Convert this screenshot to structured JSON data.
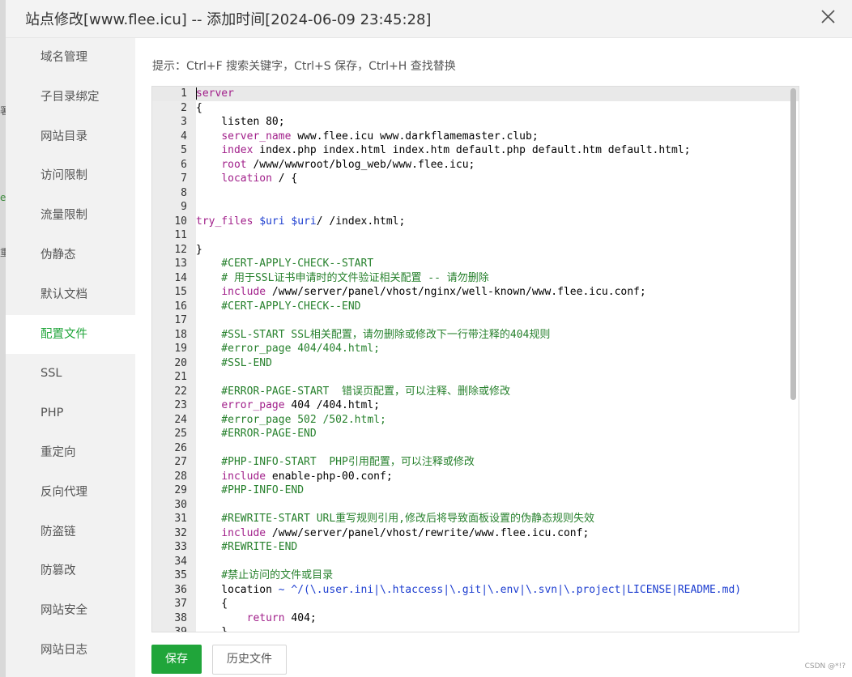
{
  "dialog": {
    "title": "站点修改[www.flee.icu] -- 添加时间[2024-06-09 23:45:28]"
  },
  "backdrop_glyphs": [
    "署",
    "e",
    "重"
  ],
  "sidebar": {
    "active_index": 7,
    "items": [
      {
        "label": "域名管理"
      },
      {
        "label": "子目录绑定"
      },
      {
        "label": "网站目录"
      },
      {
        "label": "访问限制"
      },
      {
        "label": "流量限制"
      },
      {
        "label": "伪静态"
      },
      {
        "label": "默认文档"
      },
      {
        "label": "配置文件"
      },
      {
        "label": "SSL"
      },
      {
        "label": "PHP"
      },
      {
        "label": "重定向"
      },
      {
        "label": "反向代理"
      },
      {
        "label": "防盗链"
      },
      {
        "label": "防篡改"
      },
      {
        "label": "网站安全"
      },
      {
        "label": "网站日志"
      }
    ]
  },
  "editor": {
    "hint": "提示：Ctrl+F 搜索关键字，Ctrl+S 保存，Ctrl+H 查找替换",
    "lines": [
      {
        "n": "1",
        "parts": [
          {
            "t": "server",
            "c": "kw"
          }
        ]
      },
      {
        "n": "2",
        "parts": [
          {
            "t": "{",
            "c": ""
          }
        ]
      },
      {
        "n": "3",
        "parts": [
          {
            "t": "    listen 80;",
            "c": ""
          }
        ]
      },
      {
        "n": "4",
        "parts": [
          {
            "t": "    ",
            "c": ""
          },
          {
            "t": "server_name",
            "c": "kw"
          },
          {
            "t": " www.flee.icu www.darkflamemaster.club;",
            "c": ""
          }
        ]
      },
      {
        "n": "5",
        "parts": [
          {
            "t": "    ",
            "c": ""
          },
          {
            "t": "index",
            "c": "kw"
          },
          {
            "t": " index.php index.html index.htm default.php default.htm default.html;",
            "c": ""
          }
        ]
      },
      {
        "n": "6",
        "parts": [
          {
            "t": "    ",
            "c": ""
          },
          {
            "t": "root",
            "c": "kw"
          },
          {
            "t": " /www/wwwroot/blog_web/www.flee.icu;",
            "c": ""
          }
        ]
      },
      {
        "n": "7",
        "parts": [
          {
            "t": "    ",
            "c": ""
          },
          {
            "t": "location",
            "c": "kw"
          },
          {
            "t": " / {",
            "c": ""
          }
        ]
      },
      {
        "n": "8",
        "parts": []
      },
      {
        "n": "9",
        "parts": []
      },
      {
        "n": "10",
        "parts": [
          {
            "t": "try_files",
            "c": "kw"
          },
          {
            "t": " ",
            "c": ""
          },
          {
            "t": "$uri",
            "c": "var"
          },
          {
            "t": " ",
            "c": ""
          },
          {
            "t": "$uri",
            "c": "var"
          },
          {
            "t": "/ /index.html;",
            "c": ""
          }
        ]
      },
      {
        "n": "11",
        "parts": []
      },
      {
        "n": "12",
        "parts": [
          {
            "t": "}",
            "c": ""
          }
        ]
      },
      {
        "n": "13",
        "parts": [
          {
            "t": "    #CERT-APPLY-CHECK--START",
            "c": "cm"
          }
        ]
      },
      {
        "n": "14",
        "parts": [
          {
            "t": "    # 用于SSL证书申请时的文件验证相关配置 -- 请勿删除",
            "c": "cm"
          }
        ]
      },
      {
        "n": "15",
        "parts": [
          {
            "t": "    ",
            "c": ""
          },
          {
            "t": "include",
            "c": "kw"
          },
          {
            "t": " /www/server/panel/vhost/nginx/well-known/www.flee.icu.conf;",
            "c": ""
          }
        ]
      },
      {
        "n": "16",
        "parts": [
          {
            "t": "    #CERT-APPLY-CHECK--END",
            "c": "cm"
          }
        ]
      },
      {
        "n": "17",
        "parts": []
      },
      {
        "n": "18",
        "parts": [
          {
            "t": "    #SSL-START SSL相关配置，请勿删除或修改下一行带注释的404规则",
            "c": "cm"
          }
        ]
      },
      {
        "n": "19",
        "parts": [
          {
            "t": "    #error_page 404/404.html;",
            "c": "cm"
          }
        ]
      },
      {
        "n": "20",
        "parts": [
          {
            "t": "    #SSL-END",
            "c": "cm"
          }
        ]
      },
      {
        "n": "21",
        "parts": []
      },
      {
        "n": "22",
        "parts": [
          {
            "t": "    #ERROR-PAGE-START  错误页配置，可以注释、删除或修改",
            "c": "cm"
          }
        ]
      },
      {
        "n": "23",
        "parts": [
          {
            "t": "    ",
            "c": ""
          },
          {
            "t": "error_page",
            "c": "kw"
          },
          {
            "t": " 404 /404.html;",
            "c": ""
          }
        ]
      },
      {
        "n": "24",
        "parts": [
          {
            "t": "    #error_page 502 /502.html;",
            "c": "cm"
          }
        ]
      },
      {
        "n": "25",
        "parts": [
          {
            "t": "    #ERROR-PAGE-END",
            "c": "cm"
          }
        ]
      },
      {
        "n": "26",
        "parts": []
      },
      {
        "n": "27",
        "parts": [
          {
            "t": "    #PHP-INFO-START  PHP引用配置，可以注释或修改",
            "c": "cm"
          }
        ]
      },
      {
        "n": "28",
        "parts": [
          {
            "t": "    ",
            "c": ""
          },
          {
            "t": "include",
            "c": "kw"
          },
          {
            "t": " enable-php-00.conf;",
            "c": ""
          }
        ]
      },
      {
        "n": "29",
        "parts": [
          {
            "t": "    #PHP-INFO-END",
            "c": "cm"
          }
        ]
      },
      {
        "n": "30",
        "parts": []
      },
      {
        "n": "31",
        "parts": [
          {
            "t": "    #REWRITE-START URL重写规则引用,修改后将导致面板设置的伪静态规则失效",
            "c": "cm"
          }
        ]
      },
      {
        "n": "32",
        "parts": [
          {
            "t": "    ",
            "c": ""
          },
          {
            "t": "include",
            "c": "kw"
          },
          {
            "t": " /www/server/panel/vhost/rewrite/www.flee.icu.conf;",
            "c": ""
          }
        ]
      },
      {
        "n": "33",
        "parts": [
          {
            "t": "    #REWRITE-END",
            "c": "cm"
          }
        ]
      },
      {
        "n": "34",
        "parts": []
      },
      {
        "n": "35",
        "parts": [
          {
            "t": "    #禁止访问的文件或目录",
            "c": "cm"
          }
        ]
      },
      {
        "n": "36",
        "parts": [
          {
            "t": "    location ",
            "c": ""
          },
          {
            "t": "~ ^/(\\.user.ini|\\.htaccess|\\.git|\\.env|\\.svn|\\.project|LICENSE|README.md)",
            "c": "var"
          }
        ]
      },
      {
        "n": "37",
        "parts": [
          {
            "t": "    {",
            "c": ""
          }
        ]
      },
      {
        "n": "38",
        "parts": [
          {
            "t": "        ",
            "c": ""
          },
          {
            "t": "return",
            "c": "kw"
          },
          {
            "t": " 404;",
            "c": ""
          }
        ]
      },
      {
        "n": "39",
        "parts": [
          {
            "t": "    }",
            "c": ""
          }
        ]
      }
    ]
  },
  "buttons": {
    "save": "保存",
    "history": "历史文件"
  },
  "watermark": "CSDN @*!?",
  "colors": {
    "accent": "#20a53a",
    "keyword": "#a11f8a",
    "comment": "#27812d",
    "variable": "#1d3ed0"
  }
}
